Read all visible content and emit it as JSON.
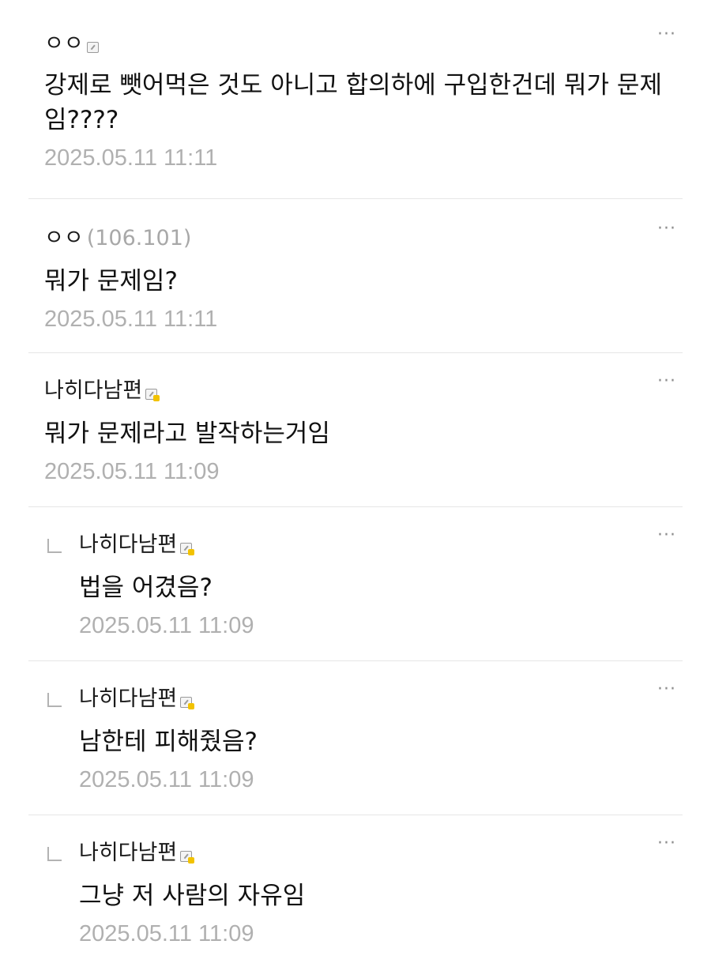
{
  "comments": [
    {
      "author": "ㅇㅇ",
      "ip": "",
      "badge": "fixed-nick-icon",
      "text": "강제로 뺏어먹은 것도 아니고 합의하에 구입한건데 뭐가 문제임????",
      "time": "2025.05.11 11:11",
      "reply": false
    },
    {
      "author": "ㅇㅇ",
      "ip": "(106.101)",
      "badge": "",
      "text": "뭐가 문제임?",
      "time": "2025.05.11 11:11",
      "reply": false
    },
    {
      "author": "나히다남편",
      "ip": "",
      "badge": "semi-fixed-nick-icon",
      "text": "뭐가 문제라고 발작하는거임",
      "time": "2025.05.11 11:09",
      "reply": false
    },
    {
      "author": "나히다남편",
      "ip": "",
      "badge": "semi-fixed-nick-icon",
      "text": "법을 어겼음?",
      "time": "2025.05.11 11:09",
      "reply": true
    },
    {
      "author": "나히다남편",
      "ip": "",
      "badge": "semi-fixed-nick-icon",
      "text": "남한테 피해줬음?",
      "time": "2025.05.11 11:09",
      "reply": true
    },
    {
      "author": "나히다남편",
      "ip": "",
      "badge": "semi-fixed-nick-icon",
      "text": "그냥 저 사람의 자유임",
      "time": "2025.05.11 11:09",
      "reply": true
    }
  ],
  "more_label": "···"
}
